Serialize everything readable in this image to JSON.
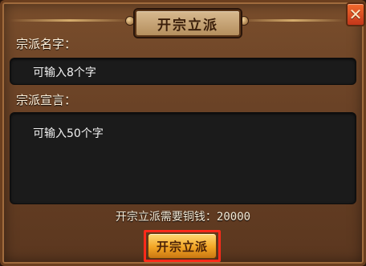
{
  "dialog": {
    "title": "开宗立派",
    "close_label": "✕"
  },
  "form": {
    "name_label": "宗派名字：",
    "name_placeholder": "可输入8个字",
    "declaration_label": "宗派宣言：",
    "declaration_placeholder": "可输入50个字"
  },
  "cost": {
    "label": "开宗立派需要铜钱：",
    "amount": "20000"
  },
  "actions": {
    "confirm_label": "开宗立派"
  },
  "colors": {
    "confirm_highlight": "#ff2a1a",
    "close_button": "#e5552a"
  }
}
